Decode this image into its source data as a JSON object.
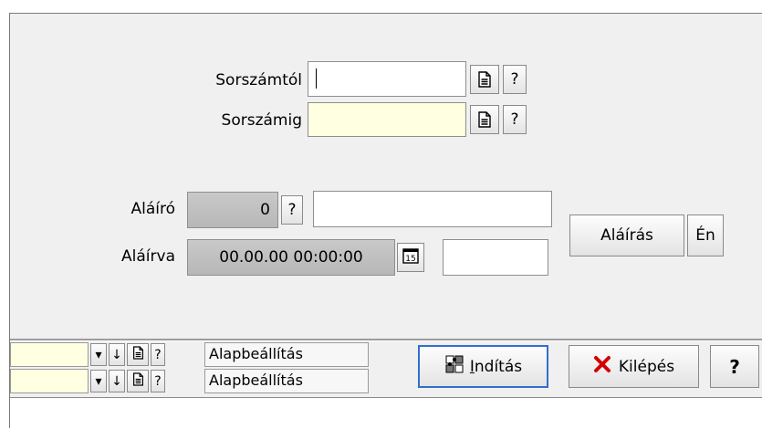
{
  "form": {
    "from_label": "Sorszámtól",
    "from_value": "",
    "to_label": "Sorszámig",
    "to_value": "",
    "help": "?",
    "signer_label": "Aláíró",
    "signer_id": "0",
    "signer_name": "",
    "signed_label": "Aláírva",
    "signed_datetime": "00.00.00 00:00:00",
    "signed_extra": "",
    "sign_button": "Aláírás",
    "me_button": "Én"
  },
  "toolbar": {
    "rows": [
      {
        "value": "",
        "preset": "Alapbeállítás"
      },
      {
        "value": "",
        "preset": "Alapbeállítás"
      }
    ],
    "start_label_first": "I",
    "start_label_rest": "ndítás",
    "exit_label": "Kilépés",
    "help_label": "?"
  },
  "colors": {
    "window_bg": "#f0f0f0",
    "input_yellow": "#ffffe1",
    "exit_icon": "#d40000"
  },
  "icons": {
    "doc": "document-icon",
    "calendar": "calendar-icon",
    "start": "puzzle-icon",
    "exit": "red-x-icon",
    "dropdown": "dropdown-arrow-icon",
    "sort": "down-arrow-icon"
  }
}
